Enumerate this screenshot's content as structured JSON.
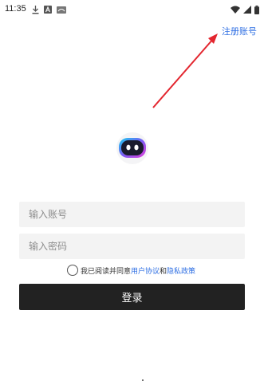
{
  "status_bar": {
    "time": "11:35",
    "icons_left": [
      "download-icon",
      "app-a-icon",
      "app-cloud-icon"
    ],
    "icons_right": [
      "wifi-icon",
      "signal-icon",
      "battery-icon"
    ]
  },
  "header": {
    "register_label": "注册账号"
  },
  "form": {
    "account_placeholder": "输入账号",
    "password_placeholder": "输入密码",
    "agreement_prefix": "我已阅读并同意",
    "user_agreement": "用户协议",
    "and": "和",
    "privacy_policy": "隐私政策",
    "login_label": "登录"
  },
  "colors": {
    "link": "#2f6fe3",
    "button": "#222222",
    "input_bg": "#f3f3f3",
    "arrow": "#e3262f"
  }
}
